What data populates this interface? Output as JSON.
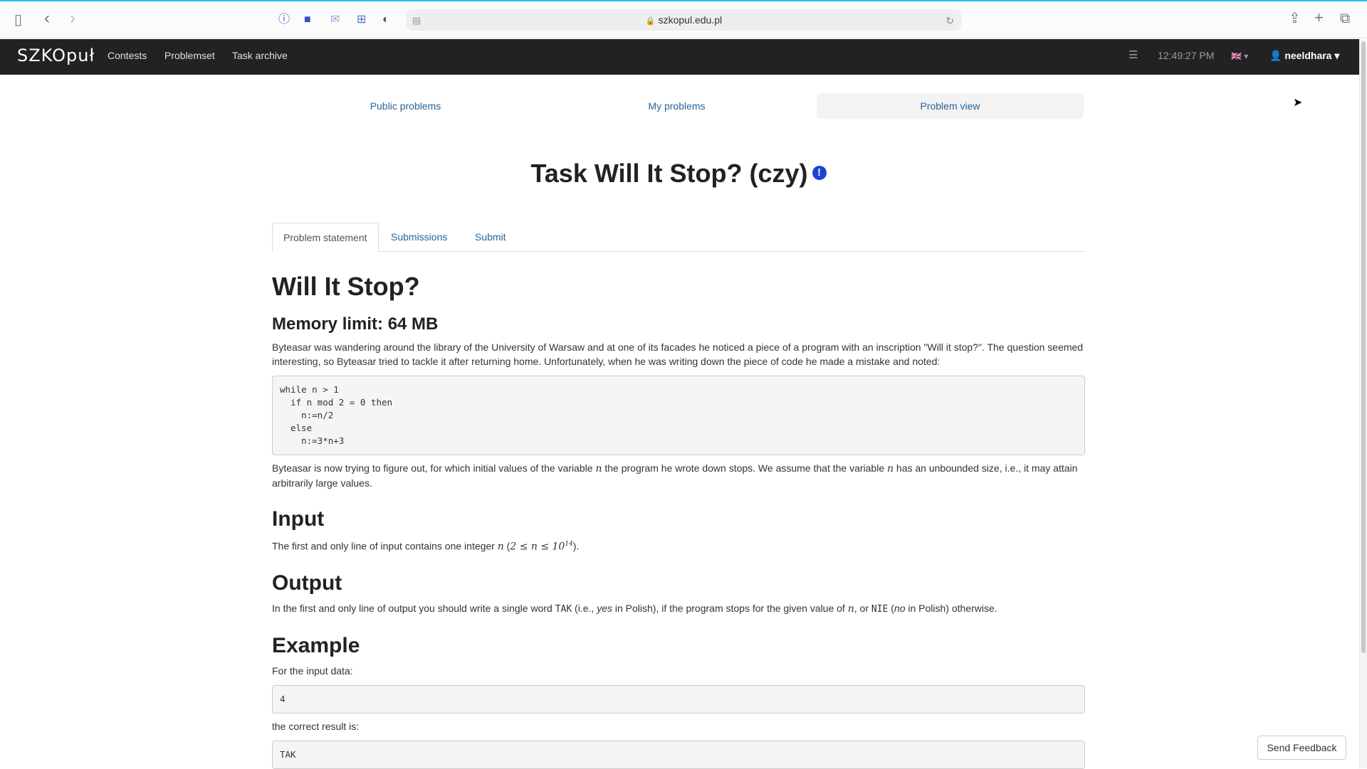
{
  "browser": {
    "url": "szkopul.edu.pl"
  },
  "icons": {
    "sidebar_toggle": "sidebar-icon",
    "back": "chevron-left-icon",
    "forward": "chevron-right-icon",
    "reload": "reload-icon",
    "share": "share-icon",
    "new_tab": "plus-icon",
    "tabs_overview": "tabs-icon"
  },
  "navbar": {
    "logo": "SZKOpuł",
    "links": [
      "Contests",
      "Problemset",
      "Task archive"
    ],
    "time": "12:49:27 PM",
    "username": "neeldhara"
  },
  "subnav": {
    "items": [
      "Public problems",
      "My problems",
      "Problem view"
    ],
    "active_index": 2
  },
  "title": "Task Will It Stop? (czy)",
  "tabs": [
    "Problem statement",
    "Submissions",
    "Submit"
  ],
  "statement": {
    "heading": "Will It Stop?",
    "memory": "Memory limit: 64 MB",
    "intro": "Byteasar was wandering around the library of the University of Warsaw and at one of its facades he noticed a piece of a program with an inscription \"Will it stop?\". The question seemed interesting, so Byteasar tried to tackle it after returning home. Unfortunately, when he was writing down the piece of code he made a mistake and noted:",
    "code": "while n > 1\n  if n mod 2 = 0 then\n    n:=n/2\n  else\n    n:=3*n+3",
    "para2_a": "Byteasar is now trying to figure out, for which initial values of the variable ",
    "para2_var": "n",
    "para2_b": " the program he wrote down stops. We assume that the variable ",
    "para2_c": " has an unbounded size, i.e., it may attain arbitrarily large values.",
    "input_heading": "Input",
    "input_a": "The first and only line of input contains one integer ",
    "input_var": "n",
    "input_b": " (",
    "input_math": "2 ≤ n ≤ 10",
    "input_exp": "14",
    "input_c": ").",
    "output_heading": "Output",
    "output_a": "In the first and only line of output you should write a single word ",
    "output_tak": "TAK",
    "output_b": " (i.e., ",
    "output_yes": "yes",
    "output_c": " in Polish), if the program stops for the given value of ",
    "output_var": "n",
    "output_d": ", or ",
    "output_nie": "NIE",
    "output_e": " (",
    "output_no": "no",
    "output_f": " in Polish) otherwise.",
    "example_heading": "Example",
    "for_input": "For the input data:",
    "sample_input": "4",
    "correct_result": "the correct result is:",
    "sample_output": "TAK"
  },
  "feedback_button": "Send Feedback"
}
